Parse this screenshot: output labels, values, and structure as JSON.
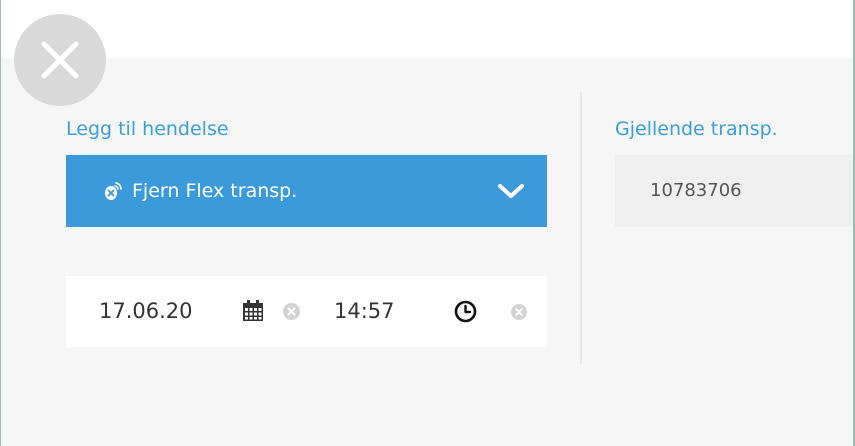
{
  "dialog": {
    "close_icon": "close-icon"
  },
  "add_event": {
    "label": "Legg til hendelse",
    "selected_option": "Fjern Flex transp.",
    "option_icon": "transponder-remove-icon",
    "dropdown_icon": "chevron-down-icon",
    "date_value": "17.06.20",
    "time_value": "14:57",
    "calendar_icon": "calendar-icon",
    "clock_icon": "clock-icon",
    "clear_icon": "clear-icon"
  },
  "current_transponder": {
    "label": "Gjellende transp.",
    "value": "10783706"
  },
  "colors": {
    "accent": "#3b9ad9",
    "label": "#3a9fd8",
    "panel_bg": "#f6f6f6",
    "close_bg": "#d9d9d9"
  }
}
